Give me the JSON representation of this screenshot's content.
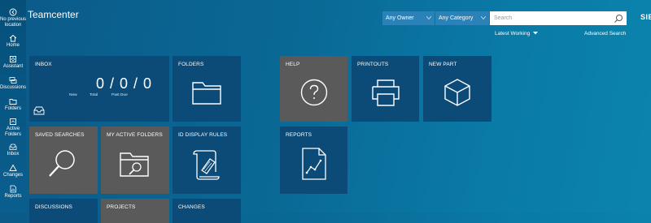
{
  "app": {
    "title": "Teamcenter",
    "brand": "SIE"
  },
  "leftnav": {
    "items": [
      {
        "label": "No previous location",
        "icon": "back-arrow-icon"
      },
      {
        "label": "Home",
        "icon": "home-icon"
      },
      {
        "label": "Assistant",
        "icon": "assistant-icon"
      },
      {
        "label": "Discussions",
        "icon": "discussions-icon"
      },
      {
        "label": "Folders",
        "icon": "folder-icon"
      },
      {
        "label": "Active Folders",
        "icon": "active-folders-icon"
      },
      {
        "label": "Inbox",
        "icon": "inbox-icon"
      },
      {
        "label": "Changes",
        "icon": "changes-icon"
      },
      {
        "label": "Reports",
        "icon": "reports-icon"
      }
    ]
  },
  "search": {
    "owner": "Any Owner",
    "category": "Any Category",
    "placeholder": "Search",
    "revision_rule": "Latest Working",
    "advanced": "Advanced Search"
  },
  "tiles": {
    "inbox": {
      "label": "INBOX",
      "counts": "0 / 0 / 0",
      "new": "New",
      "total": "Total",
      "past_due": "Past Due"
    },
    "folders": {
      "label": "FOLDERS"
    },
    "help": {
      "label": "HELP"
    },
    "printouts": {
      "label": "PRINTOUTS"
    },
    "new_part": {
      "label": "NEW PART"
    },
    "saved_searches": {
      "label": "SAVED SEARCHES"
    },
    "my_active_folders": {
      "label": "MY ACTIVE FOLDERS"
    },
    "id_display_rules": {
      "label": "ID DISPLAY RULES"
    },
    "reports": {
      "label": "REPORTS"
    },
    "discussions": {
      "label": "DISCUSSIONS"
    },
    "projects": {
      "label": "PROJECTS"
    },
    "changes": {
      "label": "CHANGES"
    }
  },
  "colors": {
    "tile_blue": "#0c4b77",
    "tile_gray": "#5a5a5a",
    "background": "#0a6996"
  }
}
